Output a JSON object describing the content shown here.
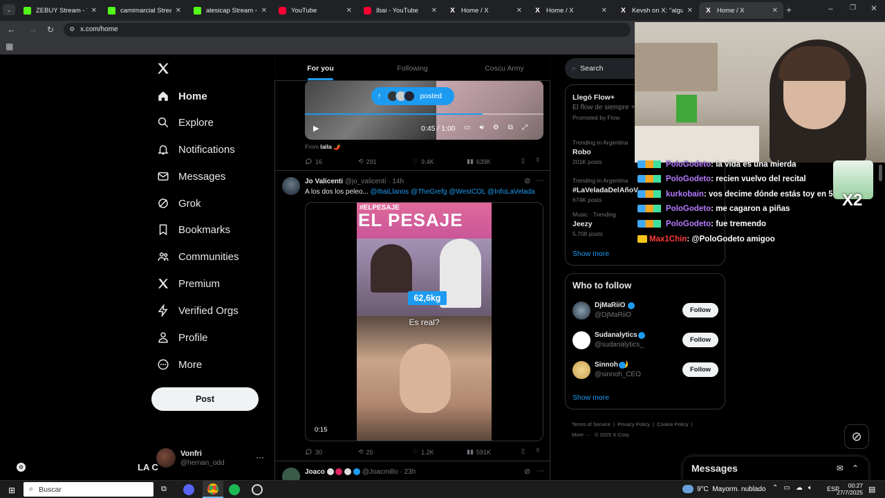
{
  "browser": {
    "tabs": [
      {
        "title": "ZEBUY Stream - Wat",
        "favicon": "kick-icon",
        "color": "#53fc18"
      },
      {
        "title": "camimarcial Stream -",
        "favicon": "kick-icon",
        "color": "#53fc18"
      },
      {
        "title": "alesicap Stream - Wa",
        "favicon": "kick-icon",
        "color": "#53fc18"
      },
      {
        "title": "YouTube",
        "favicon": "youtube-icon",
        "color": "#ff0033"
      },
      {
        "title": "Ibai - YouTube",
        "favicon": "youtube-icon",
        "color": "#ff0033"
      },
      {
        "title": "Home / X",
        "favicon": "x-icon",
        "color": "#ffffff"
      },
      {
        "title": "Home / X",
        "favicon": "x-icon",
        "color": "#ffffff"
      },
      {
        "title": "Kevsh on X: \"alguien",
        "favicon": "x-icon",
        "color": "#ffffff"
      },
      {
        "title": "Home / X",
        "favicon": "x-icon",
        "color": "#ffffff",
        "active": true
      }
    ],
    "url": "x.com/home"
  },
  "sidebar": {
    "items": [
      {
        "label": "Home",
        "icon": "home-icon",
        "active": true
      },
      {
        "label": "Explore",
        "icon": "search-icon"
      },
      {
        "label": "Notifications",
        "icon": "bell-icon"
      },
      {
        "label": "Messages",
        "icon": "mail-icon"
      },
      {
        "label": "Grok",
        "icon": "grok-icon"
      },
      {
        "label": "Bookmarks",
        "icon": "bookmark-icon"
      },
      {
        "label": "Communities",
        "icon": "people-icon"
      },
      {
        "label": "Premium",
        "icon": "x-icon"
      },
      {
        "label": "Verified Orgs",
        "icon": "lightning-icon"
      },
      {
        "label": "Profile",
        "icon": "person-icon"
      },
      {
        "label": "More",
        "icon": "more-circle-icon"
      }
    ],
    "post_label": "Post",
    "account": {
      "name": "Vonfri",
      "handle": "@hernan_odd"
    },
    "overlay_text": "LA C"
  },
  "feed": {
    "tabs": [
      "For you",
      "Following",
      "Coscu Army"
    ],
    "posted_pill": "posted",
    "video1": {
      "time": "0:45 / 1:00"
    },
    "from_label": "From",
    "from_name": "laila 🌶️",
    "post1_stats": {
      "replies": "16",
      "reposts": "291",
      "likes": "9.4K",
      "views": "639K"
    },
    "post2": {
      "name": "Jo Valicenti",
      "handle": "@jo_valicenti",
      "time": "· 14h",
      "text": "A los dos los peleo...",
      "mentions": "@IbaiLlanos @TheGrefg @WestCOL @InfoLaVelada",
      "video_overlay_top": "#ELPESAJE",
      "video_banner": "EL PESAJE",
      "weight": "62,6kg",
      "question": "Es real?",
      "duration": "0:15",
      "stats": {
        "replies": "30",
        "reposts": "25",
        "likes": "1.2K",
        "views": "591K"
      }
    },
    "post3": {
      "name": "Joaco",
      "handle": "@Joacmillo",
      "time": "· 23h"
    }
  },
  "right": {
    "search_placeholder": "Search",
    "promo": {
      "title": "Llegó Flow+",
      "subtitle": "El flow de siempre +",
      "promoted": "Promoted by Flow"
    },
    "trends": [
      {
        "category": "Trending in Argentina",
        "name": "Robo",
        "posts": "201K posts"
      },
      {
        "category": "Trending in Argentina",
        "name": "#LaVeladaDelAñoV",
        "posts": "674K posts"
      },
      {
        "category": "Music · Trending",
        "name": "Jeezy",
        "posts": "5,708 posts"
      }
    ],
    "show_more": "Show more",
    "who_to_follow_title": "Who to follow",
    "follow": [
      {
        "name": "DjMaRiiO",
        "handle": "@DjMaRiiO",
        "button": "Follow"
      },
      {
        "name": "Sudanalytics",
        "handle": "@sudanalytics_",
        "button": "Follow"
      },
      {
        "name": "Sinnoh 🌙",
        "handle": "@sinnoh_CEO",
        "button": "Follow"
      }
    ],
    "show_more2": "Show more",
    "footer": [
      "Terms of Service",
      "Privacy Policy",
      "Cookie Policy",
      "More ···",
      "© 2025 X Corp."
    ],
    "messages_title": "Messages"
  },
  "stream_chat": [
    {
      "user": "PoloGodeto",
      "color": "#b57bff",
      "msg": ": la vida es una mierda"
    },
    {
      "user": "PoloGodeto",
      "color": "#b57bff",
      "msg": ": recien vuelvo del recital"
    },
    {
      "user": "kurkobain",
      "color": "#b57bff",
      "msg": ": vos decime dónde estás toy en 5"
    },
    {
      "user": "PoloGodeto",
      "color": "#b57bff",
      "msg": ": me cagaron a piñas"
    },
    {
      "user": "PoloGodeto",
      "color": "#b57bff",
      "msg": ": fue tremendo"
    },
    {
      "user": "Max1Chin",
      "color": "#ff3b3b",
      "msg": ": @PoloGodeto amigoo"
    }
  ],
  "sticker_text": "X2",
  "taskbar": {
    "search_placeholder": "Buscar",
    "weather": "9°C  Mayorm. nublado",
    "lang": "ESP",
    "time": "00:27",
    "date": "27/7/2025"
  }
}
